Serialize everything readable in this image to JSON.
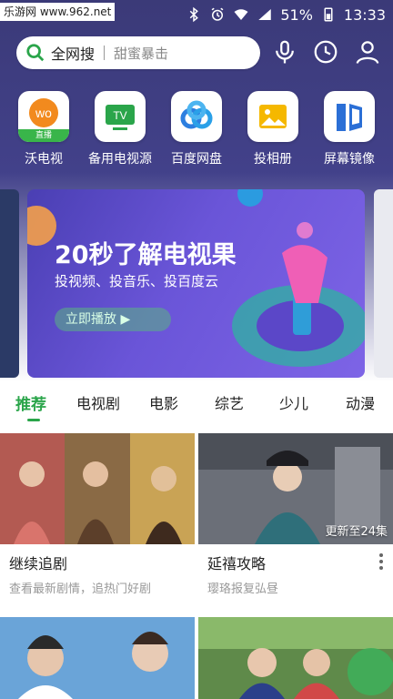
{
  "status_bar": {
    "watermark": "乐游网 www.962.net",
    "battery": "51%",
    "time": "13:33"
  },
  "search": {
    "scope": "全网搜",
    "placeholder": "甜蜜暴击"
  },
  "quick_actions": [
    {
      "label": "沃电视",
      "icon": "wo-tv-icon",
      "tag": "直播"
    },
    {
      "label": "备用电视源",
      "icon": "tv-icon",
      "tile_text": "TV"
    },
    {
      "label": "百度网盘",
      "icon": "baidu-netdisk-icon"
    },
    {
      "label": "投相册",
      "icon": "photo-album-icon"
    },
    {
      "label": "屏幕镜像",
      "icon": "screen-mirror-icon"
    }
  ],
  "banner": {
    "title": "20秒了解电视果",
    "subtitle": "投视频、投音乐、投百度云",
    "cta": "立即播放 ▶"
  },
  "tabs": [
    "推荐",
    "电视剧",
    "电影",
    "综艺",
    "少儿",
    "动漫"
  ],
  "cards": [
    {
      "title": "继续追剧",
      "subtitle": "查看最新剧情，追热门好剧"
    },
    {
      "title": "延禧攻略",
      "subtitle": "璎珞报复弘昼",
      "badge": "更新至24集"
    }
  ],
  "colors": {
    "accent": "#2aa54a",
    "header_bg": "#3b3a78",
    "banner": "#6a55d8"
  }
}
